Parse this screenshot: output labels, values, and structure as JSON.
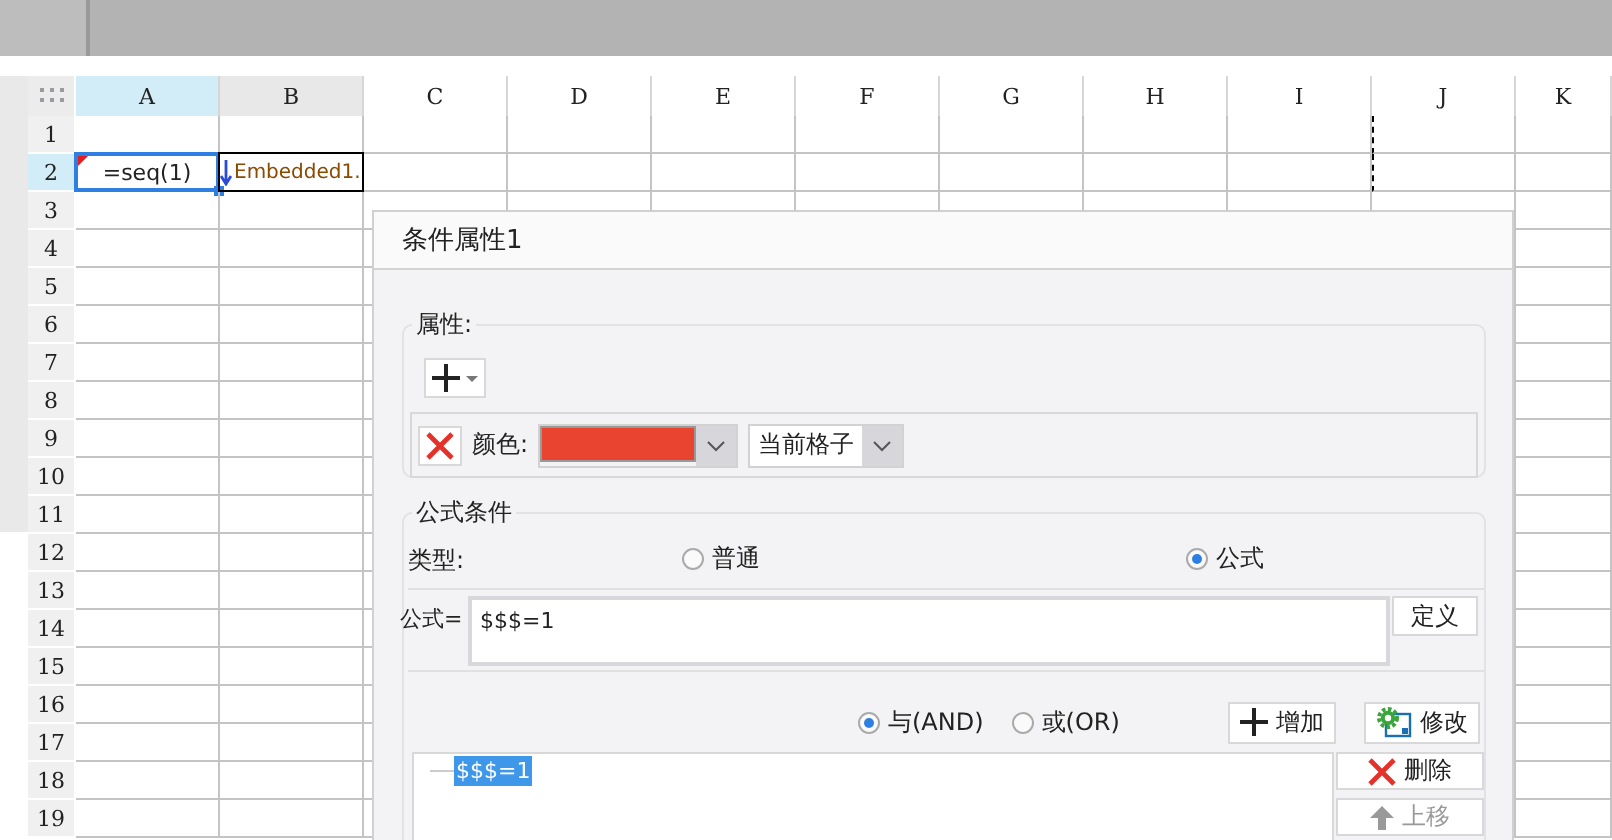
{
  "sheet": {
    "columns": [
      {
        "label": "A",
        "selected": true
      },
      {
        "label": "B",
        "selected": false
      },
      {
        "label": "C",
        "selected": false
      },
      {
        "label": "D",
        "selected": false
      },
      {
        "label": "E",
        "selected": false
      },
      {
        "label": "F",
        "selected": false
      },
      {
        "label": "G",
        "selected": false
      },
      {
        "label": "H",
        "selected": false
      },
      {
        "label": "I",
        "selected": false
      },
      {
        "label": "J",
        "selected": false
      },
      {
        "label": "K",
        "selected": false
      }
    ],
    "rows": [
      {
        "label": "1",
        "selected": false
      },
      {
        "label": "2",
        "selected": true,
        "cells": [
          {
            "kind": "formula",
            "text": "=seq(1)",
            "selected": true
          },
          {
            "kind": "embedded",
            "text": "Embedded1.",
            "selected": false
          }
        ]
      },
      {
        "label": "3",
        "selected": false
      },
      {
        "label": "4",
        "selected": false
      },
      {
        "label": "5",
        "selected": false
      },
      {
        "label": "6",
        "selected": false
      },
      {
        "label": "7",
        "selected": false
      },
      {
        "label": "8",
        "selected": false
      },
      {
        "label": "9",
        "selected": false
      },
      {
        "label": "10",
        "selected": false
      },
      {
        "label": "11",
        "selected": false
      },
      {
        "label": "12",
        "selected": false
      },
      {
        "label": "13",
        "selected": false
      },
      {
        "label": "14",
        "selected": false
      },
      {
        "label": "15",
        "selected": false
      },
      {
        "label": "16",
        "selected": false
      },
      {
        "label": "17",
        "selected": false
      },
      {
        "label": "18",
        "selected": false
      },
      {
        "label": "19",
        "selected": false
      }
    ]
  },
  "dialog": {
    "title": "条件属性1",
    "properties": {
      "legend": "属性:",
      "color_label": "颜色:",
      "color": "#e84430",
      "scope": "当前格子"
    },
    "formula_condition": {
      "legend": "公式条件",
      "type_label": "类型:",
      "type_options": [
        {
          "label": "普通",
          "selected": false
        },
        {
          "label": "公式",
          "selected": true
        }
      ],
      "formula_label": "公式=",
      "formula_value": "$$$=1",
      "define_button": "定义",
      "logic_options": [
        {
          "label": "与(AND)",
          "selected": true
        },
        {
          "label": "或(OR)",
          "selected": false
        }
      ],
      "add_button": "增加",
      "modify_button": "修改",
      "conditions": [
        {
          "text": "$$$=1",
          "selected": true
        }
      ],
      "delete_button": "删除",
      "move_up_button": {
        "label": "上移",
        "disabled": true
      }
    }
  }
}
